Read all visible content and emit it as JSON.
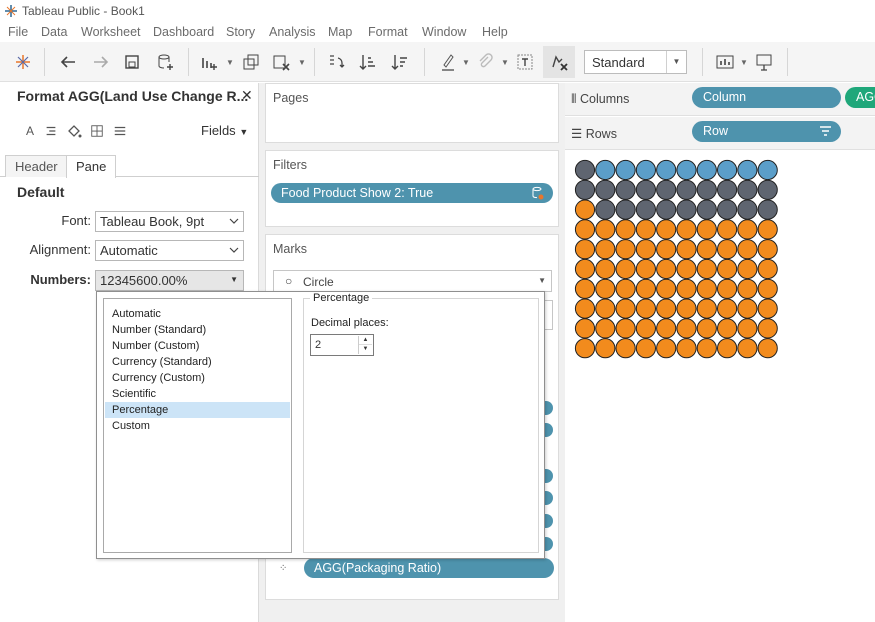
{
  "window": {
    "title": "Tableau Public - Book1"
  },
  "menu": [
    "File",
    "Data",
    "Worksheet",
    "Dashboard",
    "Story",
    "Analysis",
    "Map",
    "Format",
    "Window",
    "Help"
  ],
  "toolbar": {
    "view_size": "Standard"
  },
  "format_pane": {
    "title": "Format AGG(Land Use Change R...",
    "fields_label": "Fields",
    "tabs": [
      "Header",
      "Pane"
    ],
    "active_tab": "Pane",
    "section": "Default",
    "font_label": "Font:",
    "font_value": "Tableau Book, 9pt",
    "alignment_label": "Alignment:",
    "alignment_value": "Automatic",
    "numbers_label": "Numbers:",
    "numbers_value": "12345600.00%"
  },
  "number_format": {
    "options": [
      "Automatic",
      "Number (Standard)",
      "Number (Custom)",
      "Currency (Standard)",
      "Currency (Custom)",
      "Scientific",
      "Percentage",
      "Custom"
    ],
    "selected": "Percentage",
    "group_title": "Percentage",
    "decimal_label": "Decimal places:",
    "decimal_value": "2"
  },
  "shelves": {
    "pages_label": "Pages",
    "filters_label": "Filters",
    "filter_pill": "Food Product Show 2: True",
    "marks_label": "Marks",
    "mark_type": "Circle",
    "bottom_pill": "AGG(Packaging Ratio)",
    "columns_label": "Columns",
    "columns_pills": [
      "Column",
      "AGG"
    ],
    "rows_label": "Rows",
    "rows_pill": "Row"
  },
  "viz": {
    "grid_cols": 10,
    "grid_rows": 10,
    "row_colors": [
      [
        "dark",
        "blue",
        "blue",
        "blue",
        "blue",
        "blue",
        "blue",
        "blue",
        "blue",
        "blue"
      ],
      [
        "dark",
        "dark",
        "dark",
        "dark",
        "dark",
        "dark",
        "dark",
        "dark",
        "dark",
        "dark"
      ],
      [
        "orange",
        "dark",
        "dark",
        "dark",
        "dark",
        "dark",
        "dark",
        "dark",
        "dark",
        "dark"
      ],
      [
        "orange",
        "orange",
        "orange",
        "orange",
        "orange",
        "orange",
        "orange",
        "orange",
        "orange",
        "orange"
      ],
      [
        "orange",
        "orange",
        "orange",
        "orange",
        "orange",
        "orange",
        "orange",
        "orange",
        "orange",
        "orange"
      ],
      [
        "orange",
        "orange",
        "orange",
        "orange",
        "orange",
        "orange",
        "orange",
        "orange",
        "orange",
        "orange"
      ],
      [
        "orange",
        "orange",
        "orange",
        "orange",
        "orange",
        "orange",
        "orange",
        "orange",
        "orange",
        "orange"
      ],
      [
        "orange",
        "orange",
        "orange",
        "orange",
        "orange",
        "orange",
        "orange",
        "orange",
        "orange",
        "orange"
      ],
      [
        "orange",
        "orange",
        "orange",
        "orange",
        "orange",
        "orange",
        "orange",
        "orange",
        "orange",
        "orange"
      ],
      [
        "orange",
        "orange",
        "orange",
        "orange",
        "orange",
        "orange",
        "orange",
        "orange",
        "orange",
        "orange"
      ]
    ],
    "colors": {
      "blue": "#5b9ec9",
      "dark": "#5f6570",
      "orange": "#f28b1d"
    }
  },
  "colors": {
    "pill_blue": "#4e93ad",
    "pill_green": "#1fa77a",
    "accent_select": "#cce4f7"
  }
}
